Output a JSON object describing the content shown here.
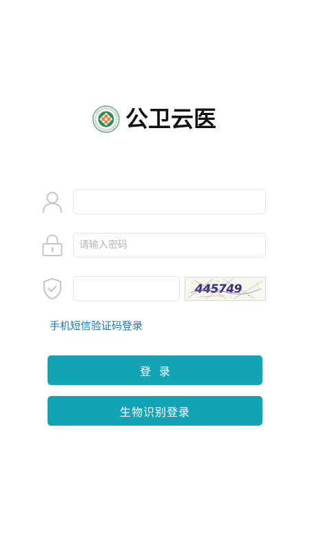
{
  "brand": {
    "title": "公卫云医",
    "logo_icon": "medical-cross-emblem-icon"
  },
  "form": {
    "username": {
      "value": "",
      "placeholder": "",
      "icon": "user-icon"
    },
    "password": {
      "value": "",
      "placeholder": "请输入密码",
      "icon": "lock-icon"
    },
    "captcha": {
      "value": "",
      "placeholder": "",
      "icon": "shield-check-icon",
      "image_text": "445749"
    }
  },
  "links": {
    "sms_login": "手机短信验证码登录"
  },
  "buttons": {
    "login": "登录",
    "biometric_login": "生物识别登录"
  },
  "colors": {
    "accent": "#14a3b4",
    "link": "#1a78b8",
    "icon_gray": "#c4c4c4",
    "logo_green": "#2e8b57",
    "logo_orange": "#e8833a"
  }
}
